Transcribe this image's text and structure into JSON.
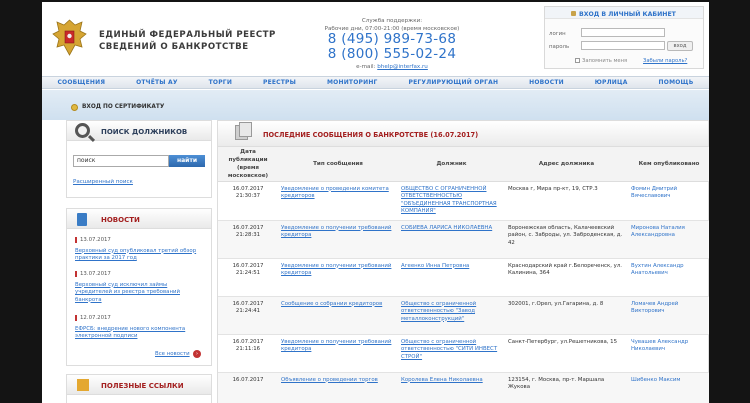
{
  "header": {
    "title_line1": "ЕДИНЫЙ ФЕДЕРАЛЬНЫЙ РЕЕСТР",
    "title_line2": "СВЕДЕНИЙ О БАНКРОТСТВЕ",
    "support_label": "Служба поддержки:",
    "support_hours": "Рабочие дни, 07:00-21:00 (время московское)",
    "phone1": "8 (495) 989-73-68",
    "phone2": "8 (800) 555-02-24",
    "email_label": "e-mail:",
    "email": "bhelp@interfax.ru"
  },
  "login": {
    "title": "ВХОД В ЛИЧНЫЙ КАБИНЕТ",
    "login_label": "логин",
    "password_label": "пароль",
    "submit": "вход",
    "remember": "Запомнить меня",
    "forgot": "Забыли пароль?"
  },
  "nav": {
    "items": [
      "СООБЩЕНИЯ",
      "ОТЧЁТЫ АУ",
      "ТОРГИ",
      "РЕЕСТРЫ",
      "МОНИТОРИНГ",
      "РЕГУЛИРУЮЩИЙ ОРГАН",
      "НОВОСТИ",
      "ЮРЛИЦА",
      "ПОМОЩЬ"
    ]
  },
  "certbar": {
    "label": "ВХОД ПО СЕРТИФИКАТУ"
  },
  "sidebar": {
    "search_title": "ПОИСК ДОЛЖНИКОВ",
    "search_value": "поиск",
    "search_button": "найти",
    "advanced": "Расширенный поиск",
    "news_title": "НОВОСТИ",
    "news": [
      {
        "date": "13.07.2017",
        "text": "Верховный суд опубликовал третий обзор практики за 2017 год"
      },
      {
        "date": "13.07.2017",
        "text": "Верховный суд исключил займы учредителей из реестра требований банкрота"
      },
      {
        "date": "12.07.2017",
        "text": "ЕФРСБ: внедрение нового компонента электронной подписи"
      }
    ],
    "more_news": "Все новости",
    "links_title": "ПОЛЕЗНЫЕ ССЫЛКИ"
  },
  "main": {
    "title": "ПОСЛЕДНИЕ СООБЩЕНИЯ О БАНКРОТСТВЕ (16.07.2017)",
    "columns": [
      "Дата публикации (время московское)",
      "Тип сообщения",
      "Должник",
      "Адрес должника",
      "Кем опубликовано"
    ],
    "rows": [
      {
        "date": "16.07.2017",
        "time": "21:30:37",
        "type": "Уведомление о проведении комитета кредиторов",
        "debtor": "ОБЩЕСТВО С ОГРАНИЧЕННОЙ ОТВЕТСТВЕННОСТЬЮ \"ОБЪЕДИНЕННАЯ ТРАНСПОРТНАЯ КОМПАНИЯ\"",
        "address": "Москва г, Мира пр-кт, 19, СТР.3",
        "publisher": "Фомин Дмитрий Вячеславович"
      },
      {
        "date": "16.07.2017",
        "time": "21:28:31",
        "type": "Уведомление о получении требований кредитора",
        "debtor": "СОБИЕВА ЛАРИСА НИКОЛАЕВНА",
        "address": "Воронежская область, Калачеевский район, с. Заброды, ул. Заброденская, д. 42",
        "publisher": "Миронова Наталия Александровна"
      },
      {
        "date": "16.07.2017",
        "time": "21:24:51",
        "type": "Уведомление о получении требований кредитора",
        "debtor": "Агеенко Инна Петровна",
        "address": "Краснодарский край г.Белореченск, ул. Калинина, 364",
        "publisher": "Вухтин Александр Анатольевич"
      },
      {
        "date": "16.07.2017",
        "time": "21:24:41",
        "type": "Сообщение о собрании кредиторов",
        "debtor": "Общество с ограниченной ответственностью \"Завод металлоконструкций\"",
        "address": "302001, г.Орел, ул.Гагарина, д. 8",
        "publisher": "Ломачев Андрей Викторович"
      },
      {
        "date": "16.07.2017",
        "time": "21:11:16",
        "type": "Уведомление о получении требований кредитора",
        "debtor": "Общество с ограниченной ответственностью \"СИТИ ИНВЕСТ СТРОЙ\"",
        "address": "Санкт-Петербург, ул.Решетникова, 15",
        "publisher": "Чувашев Александр Николаевич"
      },
      {
        "date": "16.07.2017",
        "time": "",
        "type": "Объявление о проведении торгов",
        "debtor": "Королева Елена Николаевна",
        "address": "123154, г. Москва, пр-т. Маршала Жукова",
        "publisher": "Шибенко Максим"
      }
    ]
  }
}
